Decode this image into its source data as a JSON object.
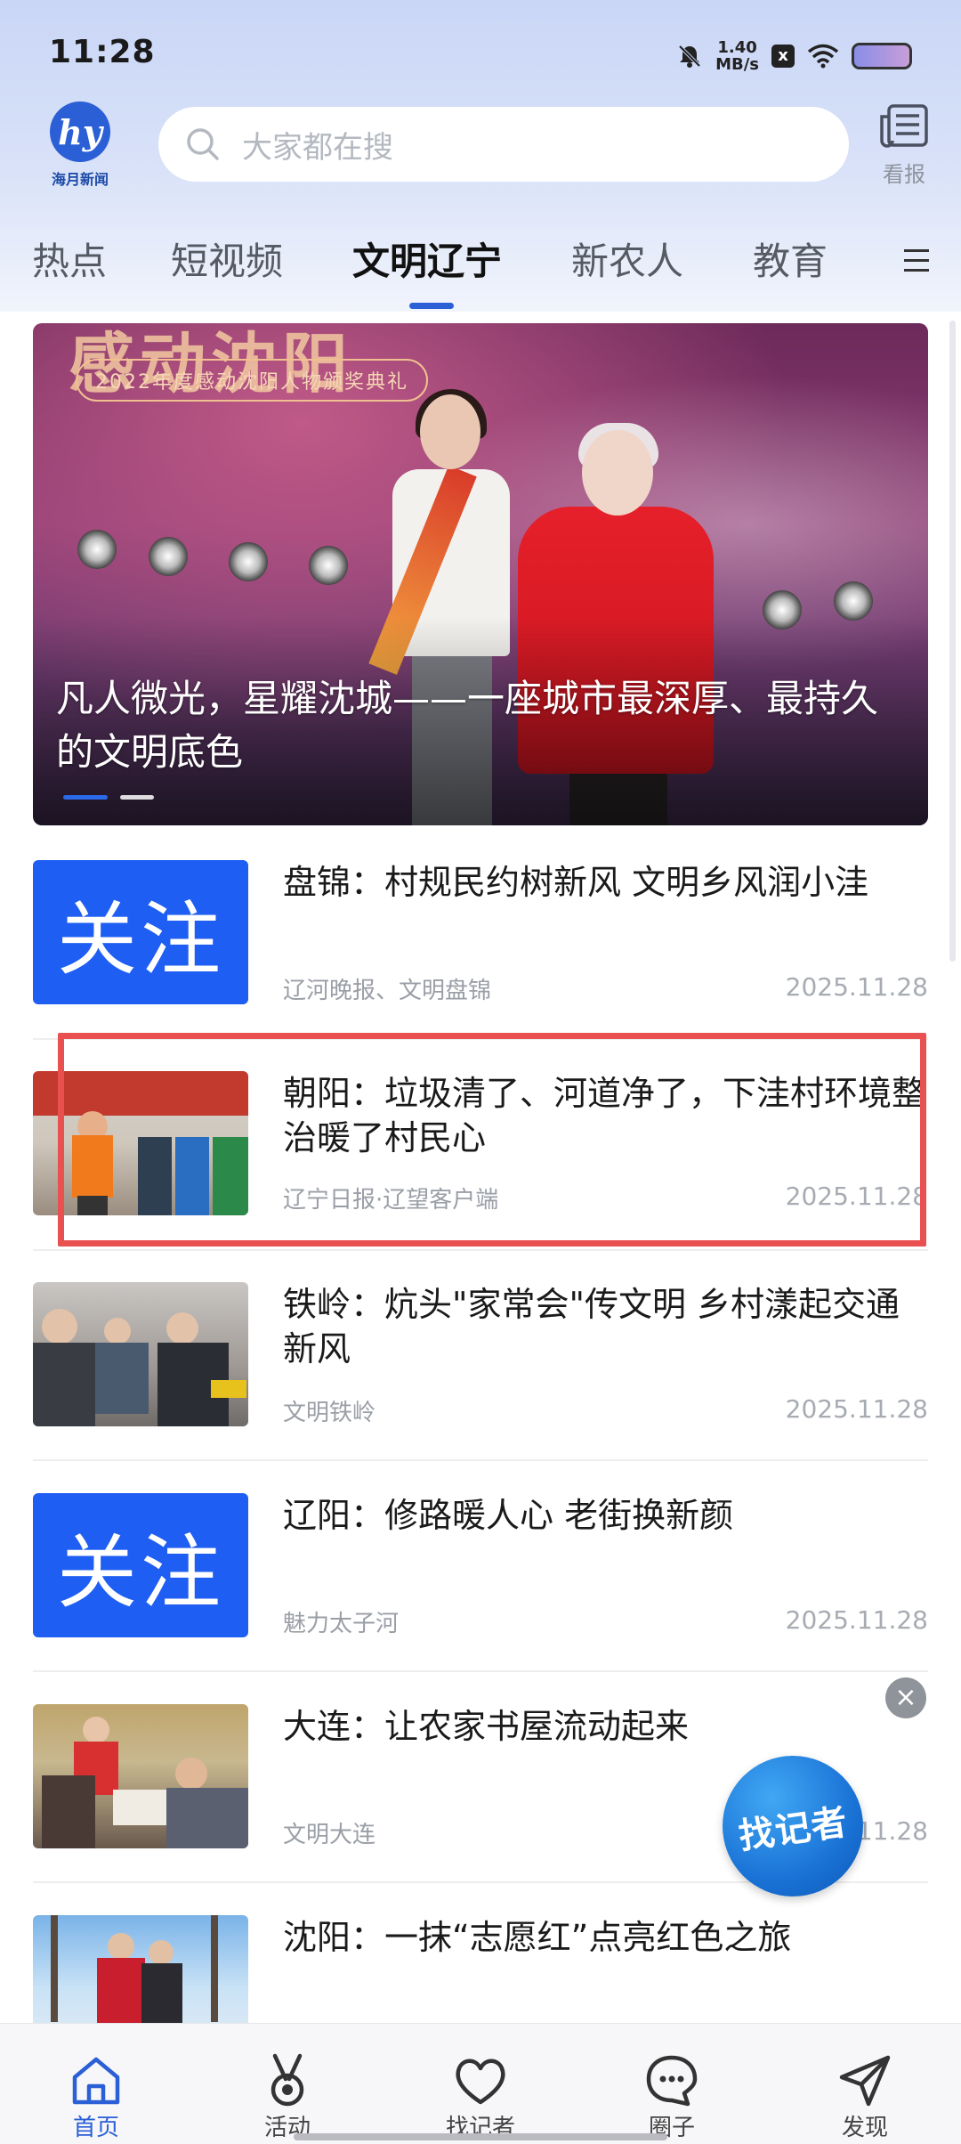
{
  "status_bar": {
    "time": "11:28",
    "net_speed_value": "1.40",
    "net_speed_unit": "MB/s",
    "sim_badge": "x"
  },
  "header": {
    "logo_text": "海月新闻",
    "search_placeholder": "大家都在搜",
    "kanbao_label": "看报"
  },
  "tabs": [
    {
      "label": "热点",
      "active": false
    },
    {
      "label": "短视频",
      "active": false
    },
    {
      "label": "文明辽宁",
      "active": true
    },
    {
      "label": "新农人",
      "active": false
    },
    {
      "label": "教育",
      "active": false
    }
  ],
  "banner": {
    "deco_text": "感动沈阳",
    "sub_text": "2022年度感动沈阳人物颁奖典礼",
    "title": "凡人微光，星耀沈城——一座城市最深厚、最持久的文明底色",
    "active_slide": 1,
    "slide_count": 2
  },
  "news": [
    {
      "title": "盘锦：村规民约树新风 文明乡风润小洼",
      "source": "辽河晚报、文明盘锦",
      "date": "2025.11.28",
      "thumb_text": "关注"
    },
    {
      "title": "朝阳：垃圾清了、河道净了，下洼村环境整治暖了村民心",
      "source": "辽宁日报·辽望客户端",
      "date": "2025.11.28"
    },
    {
      "title": "铁岭：炕头\"家常会\"传文明 乡村漾起交通新风",
      "source": "文明铁岭",
      "date": "2025.11.28"
    },
    {
      "title": "辽阳：修路暖人心 老街换新颜",
      "source": "魅力太子河",
      "date": "2025.11.28",
      "thumb_text": "关注"
    },
    {
      "title": "大连：让农家书屋流动起来",
      "source": "文明大连",
      "date": "2025.11.28"
    },
    {
      "title": "沈阳：一抹“志愿红”点亮红色之旅",
      "source": "",
      "date": ""
    }
  ],
  "floating": {
    "reporter_label": "找记者",
    "close_glyph": "×"
  },
  "bottom_nav": [
    {
      "label": "首页",
      "icon": "home-icon",
      "active": true
    },
    {
      "label": "活动",
      "icon": "medal-icon",
      "active": false
    },
    {
      "label": "找记者",
      "icon": "heart-icon",
      "active": false
    },
    {
      "label": "圈子",
      "icon": "chat-bubble-icon",
      "active": false
    },
    {
      "label": "发现",
      "icon": "send-icon",
      "active": false
    }
  ],
  "colors": {
    "accent": "#2a5fd6",
    "follow_blue": "#1f5ef2",
    "highlight_red": "#e95050"
  }
}
